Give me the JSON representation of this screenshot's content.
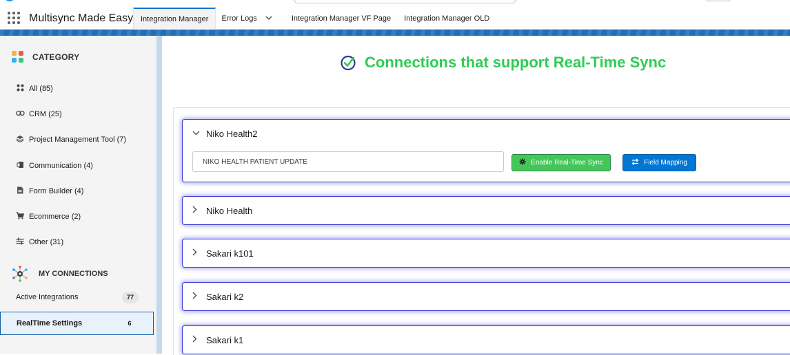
{
  "app": {
    "name": "Multisync Made Easy"
  },
  "tabs": [
    {
      "label": "Integration Manager",
      "active": true
    },
    {
      "label": "Error Logs",
      "active": false
    },
    {
      "label": "Integration Manager VF Page",
      "active": false
    },
    {
      "label": "Integration Manager OLD",
      "active": false
    }
  ],
  "sidebar": {
    "category_title": "CATEGORY",
    "categories": [
      {
        "label": "All (85)",
        "icon": "grid-icon"
      },
      {
        "label": "CRM (25)",
        "icon": "link-icon"
      },
      {
        "label": "Project Management Tool (7)",
        "icon": "layers-icon"
      },
      {
        "label": "Communication (4)",
        "icon": "chat-icon"
      },
      {
        "label": "Form Builder (4)",
        "icon": "form-icon"
      },
      {
        "label": "Ecommerce (2)",
        "icon": "cart-icon"
      },
      {
        "label": "Other (31)",
        "icon": "filter-icon"
      }
    ],
    "connections_title": "MY CONNECTIONS",
    "connections": [
      {
        "label": "Active Integrations",
        "count": "77",
        "active": false
      },
      {
        "label": "RealTime Settings",
        "count": "6",
        "active": true
      }
    ]
  },
  "main": {
    "heading": "Connections that support Real-Time Sync",
    "cards": [
      {
        "title": "Niko Health2",
        "expanded": true,
        "input_value": "NIKO HEALTH PATIENT UPDATE",
        "sync_label": "Enable Real-Time Sync",
        "mapping_label": "Field Mapping"
      },
      {
        "title": "Niko Health",
        "expanded": false
      },
      {
        "title": "Sakari k101",
        "expanded": false
      },
      {
        "title": "Sakari k2",
        "expanded": false
      },
      {
        "title": "Sakari k1",
        "expanded": false
      }
    ]
  },
  "colors": {
    "brand_blue": "#0176d3",
    "heading_green": "#2ecc55",
    "sync_green": "#45c65a",
    "card_border": "#3a3ad6"
  }
}
